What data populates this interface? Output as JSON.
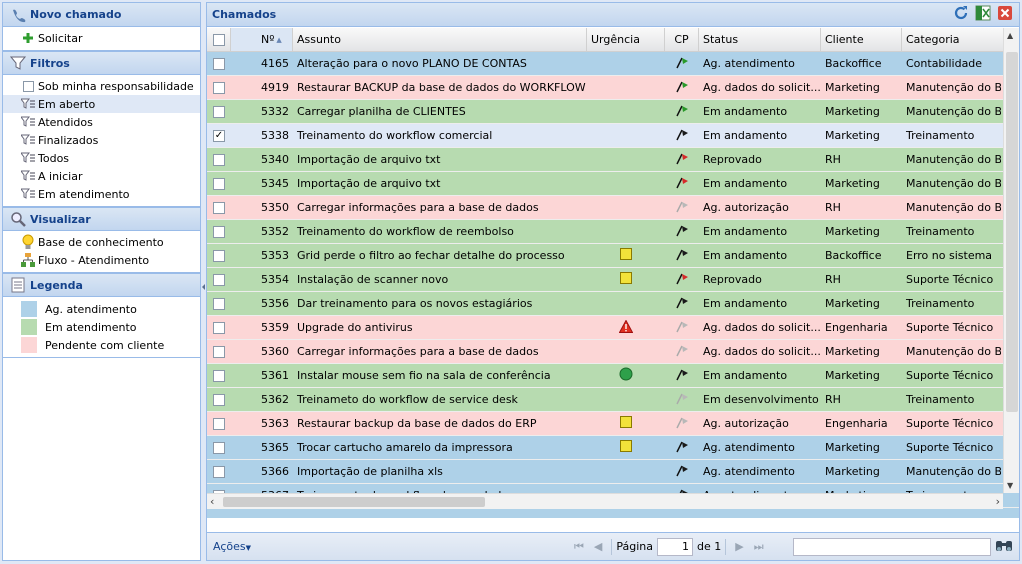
{
  "left": {
    "novo_chamado": {
      "title": "Novo chamado",
      "items": [
        {
          "label": "Solicitar",
          "icon": "plus-icon"
        }
      ]
    },
    "filtros": {
      "title": "Filtros",
      "items": [
        {
          "label": "Sob minha responsabilidade",
          "icon": "checkbox",
          "selected": false
        },
        {
          "label": "Em aberto",
          "icon": "filter-icon",
          "selected": true
        },
        {
          "label": "Atendidos",
          "icon": "filter-icon",
          "selected": false
        },
        {
          "label": "Finalizados",
          "icon": "filter-icon",
          "selected": false
        },
        {
          "label": "Todos",
          "icon": "filter-icon",
          "selected": false
        },
        {
          "label": "A iniciar",
          "icon": "filter-icon",
          "selected": false
        },
        {
          "label": "Em atendimento",
          "icon": "filter-icon",
          "selected": false
        }
      ]
    },
    "visualizar": {
      "title": "Visualizar",
      "items": [
        {
          "label": "Base de conhecimento",
          "icon": "lightbulb-icon"
        },
        {
          "label": "Fluxo - Atendimento",
          "icon": "flow-icon"
        }
      ]
    },
    "legenda": {
      "title": "Legenda",
      "items": [
        {
          "label": "Ag. atendimento",
          "color": "#aed1e8"
        },
        {
          "label": "Em atendimento",
          "color": "#b7dbb0"
        },
        {
          "label": "Pendente com cliente",
          "color": "#fcd6d6"
        }
      ]
    }
  },
  "main": {
    "title": "Chamados",
    "columns": [
      "Nº",
      "Assunto",
      "Urgência",
      "CP",
      "Status",
      "Cliente",
      "Categoria"
    ],
    "rows": [
      {
        "n": "4165",
        "assunto": "Alteração para o novo PLANO DE CONTAS",
        "urg": "",
        "cp": "green",
        "status": "Ag. atendimento",
        "cliente": "Backoffice",
        "categoria": "Contabilidade",
        "bg": "#aed1e8",
        "checked": false
      },
      {
        "n": "4919",
        "assunto": "Restaurar BACKUP da base de dados do WORKFLOW",
        "urg": "",
        "cp": "green",
        "status": "Ag. dados do solicit...",
        "cliente": "Marketing",
        "categoria": "Manutenção do BD",
        "bg": "#fcd6d6",
        "checked": false
      },
      {
        "n": "5332",
        "assunto": "Carregar planilha de CLIENTES",
        "urg": "",
        "cp": "green",
        "status": "Em andamento",
        "cliente": "Marketing",
        "categoria": "Manutenção do BD",
        "bg": "#b7dbb0",
        "checked": false
      },
      {
        "n": "5338",
        "assunto": "Treinamento do workflow comercial",
        "urg": "",
        "cp": "black",
        "status": "Em andamento",
        "cliente": "Marketing",
        "categoria": "Treinamento",
        "bg": "#dfe8f6",
        "checked": true
      },
      {
        "n": "5340",
        "assunto": "Importação de arquivo txt",
        "urg": "",
        "cp": "red",
        "status": "Reprovado",
        "cliente": "RH",
        "categoria": "Manutenção do BD",
        "bg": "#b7dbb0",
        "checked": false
      },
      {
        "n": "5345",
        "assunto": "Importação de arquivo txt",
        "urg": "",
        "cp": "red",
        "status": "Em andamento",
        "cliente": "Marketing",
        "categoria": "Manutenção do BD",
        "bg": "#b7dbb0",
        "checked": false
      },
      {
        "n": "5350",
        "assunto": "Carregar informações para a base de dados",
        "urg": "",
        "cp": "gray",
        "status": "Ag. autorização",
        "cliente": "RH",
        "categoria": "Manutenção do BD",
        "bg": "#fcd6d6",
        "checked": false
      },
      {
        "n": "5352",
        "assunto": "Treinamento do workflow de reembolso",
        "urg": "",
        "cp": "black",
        "status": "Em andamento",
        "cliente": "Marketing",
        "categoria": "Treinamento",
        "bg": "#b7dbb0",
        "checked": false
      },
      {
        "n": "5353",
        "assunto": "Grid perde o filtro ao fechar detalhe do processo",
        "urg": "square",
        "cp": "black",
        "status": "Em andamento",
        "cliente": "Backoffice",
        "categoria": "Erro no sistema",
        "bg": "#b7dbb0",
        "checked": false
      },
      {
        "n": "5354",
        "assunto": "Instalação de scanner novo",
        "urg": "square",
        "cp": "red",
        "status": "Reprovado",
        "cliente": "RH",
        "categoria": "Suporte Técnico",
        "bg": "#b7dbb0",
        "checked": false
      },
      {
        "n": "5356",
        "assunto": "Dar treinamento para os novos estagiários",
        "urg": "",
        "cp": "black",
        "status": "Em andamento",
        "cliente": "Marketing",
        "categoria": "Treinamento",
        "bg": "#b7dbb0",
        "checked": false
      },
      {
        "n": "5359",
        "assunto": "Upgrade do antivirus",
        "urg": "triangle",
        "cp": "gray",
        "status": "Ag. dados do solicit...",
        "cliente": "Engenharia",
        "categoria": "Suporte Técnico",
        "bg": "#fcd6d6",
        "checked": false
      },
      {
        "n": "5360",
        "assunto": "Carregar informações para a base de dados",
        "urg": "",
        "cp": "gray",
        "status": "Ag. dados do solicit...",
        "cliente": "Marketing",
        "categoria": "Manutenção do BD",
        "bg": "#fcd6d6",
        "checked": false
      },
      {
        "n": "5361",
        "assunto": "Instalar mouse sem fio na sala de conferência",
        "urg": "circle",
        "cp": "black",
        "status": "Em andamento",
        "cliente": "Marketing",
        "categoria": "Suporte Técnico",
        "bg": "#b7dbb0",
        "checked": false
      },
      {
        "n": "5362",
        "assunto": "Treinameto do workflow de service desk",
        "urg": "",
        "cp": "gray",
        "status": "Em desenvolvimento",
        "cliente": "RH",
        "categoria": "Treinamento",
        "bg": "#b7dbb0",
        "checked": false
      },
      {
        "n": "5363",
        "assunto": "Restaurar backup da base de dados do ERP",
        "urg": "square",
        "cp": "gray",
        "status": "Ag. autorização",
        "cliente": "Engenharia",
        "categoria": "Suporte Técnico",
        "bg": "#fcd6d6",
        "checked": false
      },
      {
        "n": "5365",
        "assunto": "Trocar cartucho amarelo da impressora",
        "urg": "square",
        "cp": "black",
        "status": "Ag. atendimento",
        "cliente": "Marketing",
        "categoria": "Suporte Técnico",
        "bg": "#aed1e8",
        "checked": false
      },
      {
        "n": "5366",
        "assunto": "Importação de planilha xls",
        "urg": "",
        "cp": "black",
        "status": "Ag. atendimento",
        "cliente": "Marketing",
        "categoria": "Manutenção do BD",
        "bg": "#aed1e8",
        "checked": false
      },
      {
        "n": "5367",
        "assunto": "Treinamento do workflow de reembolso",
        "urg": "",
        "cp": "black",
        "status": "Ag. atendimento",
        "cliente": "Marketing",
        "categoria": "Treinamento",
        "bg": "#aed1e8",
        "checked": false
      }
    ]
  },
  "footer": {
    "acoes": "Ações",
    "pagina": "Página",
    "page": "1",
    "de": "de 1",
    "search_placeholder": ""
  }
}
